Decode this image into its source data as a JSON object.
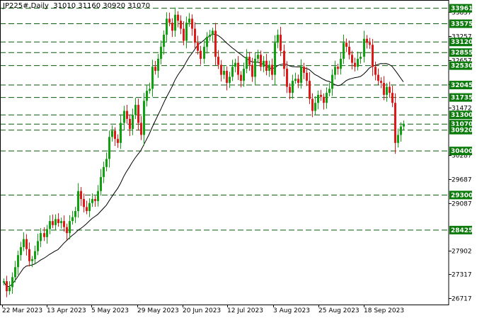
{
  "header": {
    "info": "JP225#,Daily  31010 31160 30920 31070"
  },
  "colors": {
    "bull": "#10a010",
    "bear": "#e01818",
    "level_line": "#0a5a0a",
    "level_label_bg": "#0a7a0a",
    "ma_line": "#000000",
    "axis": "#000000"
  },
  "chart_data": {
    "type": "candlestick",
    "symbol": "JP225#",
    "timeframe": "Daily",
    "last_bar": {
      "open": 31010,
      "high": 31160,
      "low": 30920,
      "close": 31070
    },
    "ylim": [
      26567,
      34061
    ],
    "y_ticks": [
      33857,
      33257,
      32657,
      32057,
      31472,
      30287,
      29687,
      29087,
      27902,
      27317,
      26717
    ],
    "x_ticks": [
      "22 Mar 2023",
      "13 Apr 2023",
      "5 May 2023",
      "29 May 2023",
      "20 Jun 2023",
      "12 Jul 2023",
      "3 Aug 2023",
      "25 Aug 2023",
      "18 Sep 2023"
    ],
    "levels": [
      33961,
      33575,
      33120,
      32855,
      32530,
      32045,
      31735,
      31300,
      31070,
      30920,
      30400,
      29300,
      28425
    ],
    "moving_average": true,
    "closes": [
      27150,
      26900,
      27000,
      27250,
      27500,
      27800,
      28000,
      28200,
      27950,
      27650,
      27700,
      27900,
      28150,
      28350,
      28250,
      28450,
      28650,
      28550,
      28700,
      28600,
      28650,
      28500,
      28350,
      28650,
      28750,
      28900,
      29400,
      29200,
      29000,
      28900,
      29100,
      29200,
      29150,
      29400,
      29750,
      30000,
      30200,
      30750,
      30900,
      30700,
      30600,
      31100,
      31400,
      31200,
      30950,
      31300,
      31550,
      31100,
      30800,
      31650,
      31900,
      31950,
      32500,
      32400,
      32700,
      33000,
      33300,
      33700,
      33600,
      33400,
      33800,
      33650,
      33450,
      33150,
      33600,
      33700,
      33450,
      33100,
      32900,
      32700,
      33000,
      33250,
      33300,
      33400,
      32750,
      32550,
      32300,
      32400,
      32100,
      32250,
      32500,
      32600,
      32300,
      32150,
      32450,
      32750,
      32550,
      32250,
      32700,
      32800,
      32500,
      32650,
      32400,
      32550,
      32300,
      33100,
      33300,
      32900,
      32450,
      32000,
      31850,
      32150,
      32200,
      32100,
      32500,
      32350,
      32150,
      31700,
      31400,
      31600,
      31800,
      31750,
      31600,
      31850,
      31950,
      32300,
      32500,
      32450,
      32700,
      33100,
      33000,
      32800,
      32600,
      32500,
      32700,
      32750,
      33200,
      33100,
      33050,
      32500,
      32300,
      32150,
      32100,
      31800,
      32000,
      31850,
      31600,
      30600,
      30800,
      31010,
      31070
    ]
  }
}
